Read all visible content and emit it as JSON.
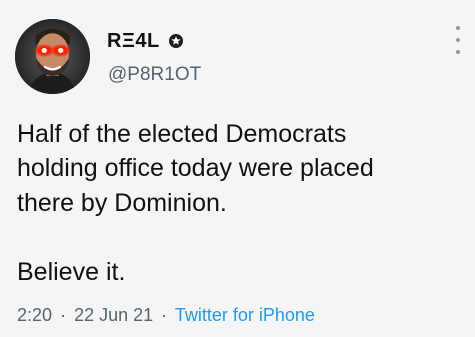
{
  "user": {
    "display_name": "RΞ4L",
    "handle": "@P8R1OT"
  },
  "tweet": {
    "body_lines": [
      "Half of the elected Democrats",
      "holding office today were placed",
      "there by Dominion.",
      "Believe it."
    ],
    "time": "2:20",
    "date": "22 Jun 21",
    "separator": "·",
    "source": "Twitter for iPhone"
  },
  "icons": {
    "verified": "verified-badge-icon",
    "more": "more-options-icon"
  },
  "colors": {
    "background": "#f5f5f5",
    "text": "#111111",
    "secondary": "#536471",
    "link": "#1d9bf0"
  }
}
